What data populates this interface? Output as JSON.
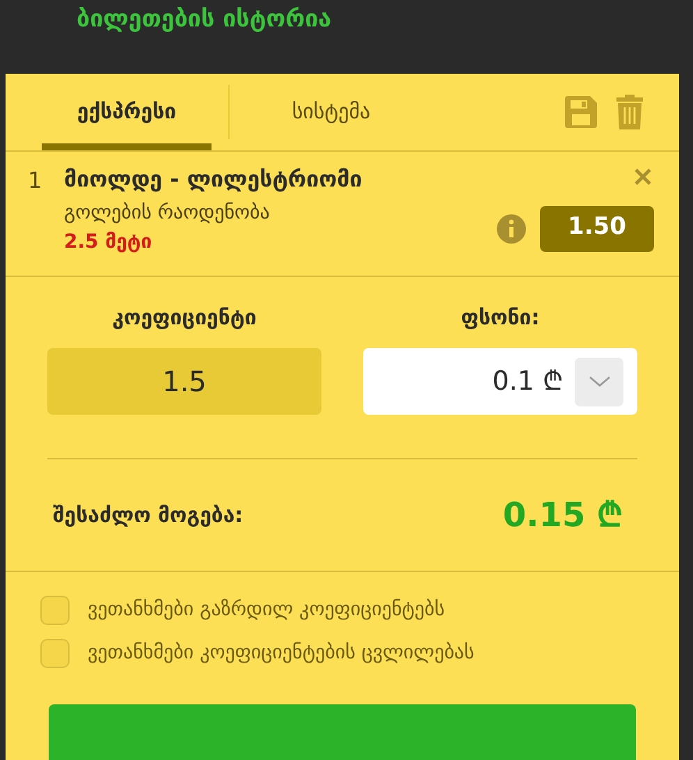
{
  "header": {
    "title": "ბილეთების ისტორია"
  },
  "tabs": [
    {
      "label": "ექსპრესი",
      "selected": true
    },
    {
      "label": "სისტემა",
      "selected": false
    }
  ],
  "bets": [
    {
      "number": "1",
      "event": "მიოლდე - ლილესტრიომი",
      "market": "გოლების რაოდენობა",
      "selection": "2.5 მეტი",
      "odds": "1.50"
    }
  ],
  "stake": {
    "odds_label": "კოეფიციენტი",
    "odds_value": "1.5",
    "stake_label": "ფსონი:",
    "stake_value": "0.1 ₾",
    "win_label": "შესაძლო მოგება:",
    "win_value": "0.15 ₾"
  },
  "options": [
    {
      "label": "ვეთანხმები გაზრდილ კოეფიციენტებს",
      "checked": false
    },
    {
      "label": "ვეთანხმები კოეფიციენტების ცვლილებას",
      "checked": false
    }
  ],
  "submit": {
    "kind": "button"
  }
}
